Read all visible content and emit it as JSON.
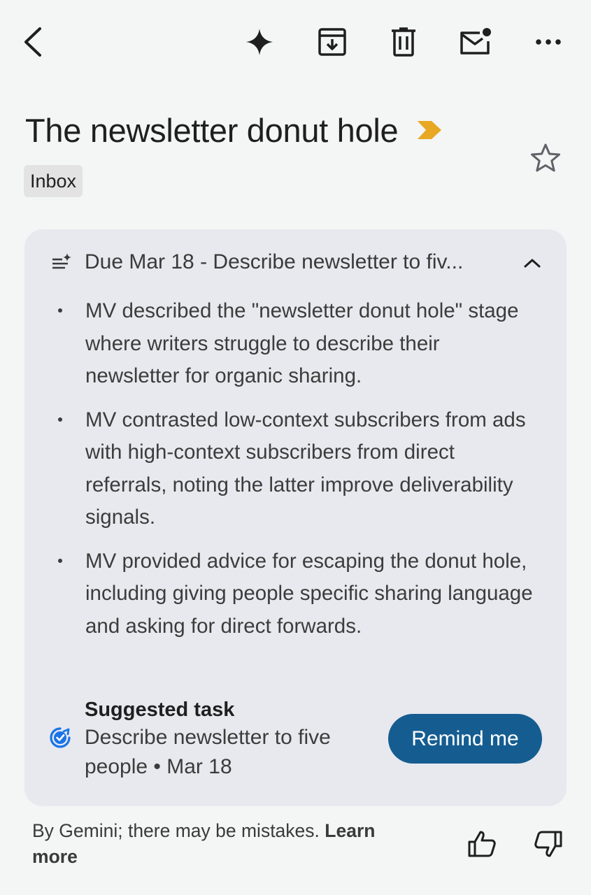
{
  "toolbar": {
    "icons": [
      "back-icon",
      "gemini-sparkle-icon",
      "archive-icon",
      "delete-icon",
      "mark-unread-icon",
      "more-icon"
    ]
  },
  "email": {
    "subject": "The newsletter donut hole",
    "label": "Inbox",
    "importance_color": "#e8a824"
  },
  "summary": {
    "title": "Due Mar 18 - Describe newsletter to fiv...",
    "bullets": [
      "MV described the \"newsletter donut hole\" stage where writers struggle to describe their newsletter for organic sharing.",
      "MV contrasted low-context subscribers from ads with high-context subscribers from direct referrals, noting the latter improve deliverability signals.",
      "MV provided advice for escaping the donut hole, including giving people specific sharing language and asking for direct forwards."
    ],
    "task": {
      "heading": "Suggested task",
      "description": "Describe newsletter to five people • Mar 18",
      "button_label": "Remind me",
      "button_color": "#155d91"
    }
  },
  "footer": {
    "disclaimer": "By Gemini; there may be mistakes.",
    "learn_more": "Learn more"
  },
  "colors": {
    "background": "#f4f5f5",
    "card": "#e7e9ee",
    "task_check": "#1a73e8"
  }
}
